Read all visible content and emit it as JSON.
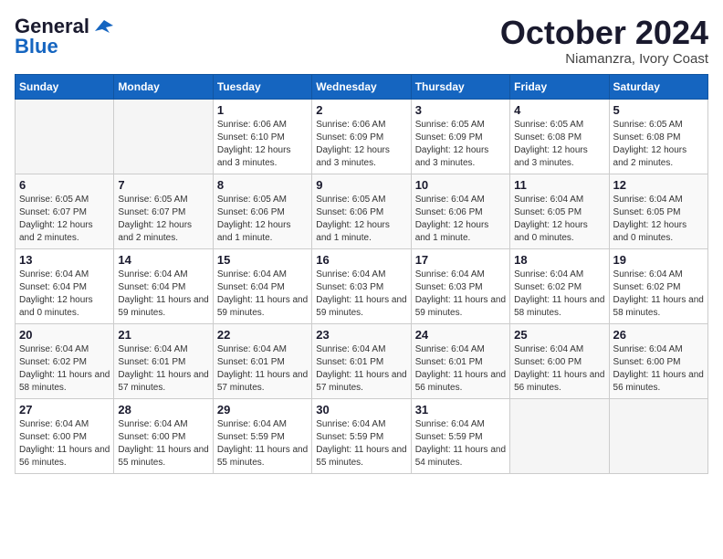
{
  "logo": {
    "general": "General",
    "blue": "Blue",
    "tagline": ""
  },
  "title": "October 2024",
  "subtitle": "Niamanzra, Ivory Coast",
  "days_header": [
    "Sunday",
    "Monday",
    "Tuesday",
    "Wednesday",
    "Thursday",
    "Friday",
    "Saturday"
  ],
  "weeks": [
    [
      {
        "day": "",
        "info": ""
      },
      {
        "day": "",
        "info": ""
      },
      {
        "day": "1",
        "info": "Sunrise: 6:06 AM\nSunset: 6:10 PM\nDaylight: 12 hours and 3 minutes."
      },
      {
        "day": "2",
        "info": "Sunrise: 6:06 AM\nSunset: 6:09 PM\nDaylight: 12 hours and 3 minutes."
      },
      {
        "day": "3",
        "info": "Sunrise: 6:05 AM\nSunset: 6:09 PM\nDaylight: 12 hours and 3 minutes."
      },
      {
        "day": "4",
        "info": "Sunrise: 6:05 AM\nSunset: 6:08 PM\nDaylight: 12 hours and 3 minutes."
      },
      {
        "day": "5",
        "info": "Sunrise: 6:05 AM\nSunset: 6:08 PM\nDaylight: 12 hours and 2 minutes."
      }
    ],
    [
      {
        "day": "6",
        "info": "Sunrise: 6:05 AM\nSunset: 6:07 PM\nDaylight: 12 hours and 2 minutes."
      },
      {
        "day": "7",
        "info": "Sunrise: 6:05 AM\nSunset: 6:07 PM\nDaylight: 12 hours and 2 minutes."
      },
      {
        "day": "8",
        "info": "Sunrise: 6:05 AM\nSunset: 6:06 PM\nDaylight: 12 hours and 1 minute."
      },
      {
        "day": "9",
        "info": "Sunrise: 6:05 AM\nSunset: 6:06 PM\nDaylight: 12 hours and 1 minute."
      },
      {
        "day": "10",
        "info": "Sunrise: 6:04 AM\nSunset: 6:06 PM\nDaylight: 12 hours and 1 minute."
      },
      {
        "day": "11",
        "info": "Sunrise: 6:04 AM\nSunset: 6:05 PM\nDaylight: 12 hours and 0 minutes."
      },
      {
        "day": "12",
        "info": "Sunrise: 6:04 AM\nSunset: 6:05 PM\nDaylight: 12 hours and 0 minutes."
      }
    ],
    [
      {
        "day": "13",
        "info": "Sunrise: 6:04 AM\nSunset: 6:04 PM\nDaylight: 12 hours and 0 minutes."
      },
      {
        "day": "14",
        "info": "Sunrise: 6:04 AM\nSunset: 6:04 PM\nDaylight: 11 hours and 59 minutes."
      },
      {
        "day": "15",
        "info": "Sunrise: 6:04 AM\nSunset: 6:04 PM\nDaylight: 11 hours and 59 minutes."
      },
      {
        "day": "16",
        "info": "Sunrise: 6:04 AM\nSunset: 6:03 PM\nDaylight: 11 hours and 59 minutes."
      },
      {
        "day": "17",
        "info": "Sunrise: 6:04 AM\nSunset: 6:03 PM\nDaylight: 11 hours and 59 minutes."
      },
      {
        "day": "18",
        "info": "Sunrise: 6:04 AM\nSunset: 6:02 PM\nDaylight: 11 hours and 58 minutes."
      },
      {
        "day": "19",
        "info": "Sunrise: 6:04 AM\nSunset: 6:02 PM\nDaylight: 11 hours and 58 minutes."
      }
    ],
    [
      {
        "day": "20",
        "info": "Sunrise: 6:04 AM\nSunset: 6:02 PM\nDaylight: 11 hours and 58 minutes."
      },
      {
        "day": "21",
        "info": "Sunrise: 6:04 AM\nSunset: 6:01 PM\nDaylight: 11 hours and 57 minutes."
      },
      {
        "day": "22",
        "info": "Sunrise: 6:04 AM\nSunset: 6:01 PM\nDaylight: 11 hours and 57 minutes."
      },
      {
        "day": "23",
        "info": "Sunrise: 6:04 AM\nSunset: 6:01 PM\nDaylight: 11 hours and 57 minutes."
      },
      {
        "day": "24",
        "info": "Sunrise: 6:04 AM\nSunset: 6:01 PM\nDaylight: 11 hours and 56 minutes."
      },
      {
        "day": "25",
        "info": "Sunrise: 6:04 AM\nSunset: 6:00 PM\nDaylight: 11 hours and 56 minutes."
      },
      {
        "day": "26",
        "info": "Sunrise: 6:04 AM\nSunset: 6:00 PM\nDaylight: 11 hours and 56 minutes."
      }
    ],
    [
      {
        "day": "27",
        "info": "Sunrise: 6:04 AM\nSunset: 6:00 PM\nDaylight: 11 hours and 56 minutes."
      },
      {
        "day": "28",
        "info": "Sunrise: 6:04 AM\nSunset: 6:00 PM\nDaylight: 11 hours and 55 minutes."
      },
      {
        "day": "29",
        "info": "Sunrise: 6:04 AM\nSunset: 5:59 PM\nDaylight: 11 hours and 55 minutes."
      },
      {
        "day": "30",
        "info": "Sunrise: 6:04 AM\nSunset: 5:59 PM\nDaylight: 11 hours and 55 minutes."
      },
      {
        "day": "31",
        "info": "Sunrise: 6:04 AM\nSunset: 5:59 PM\nDaylight: 11 hours and 54 minutes."
      },
      {
        "day": "",
        "info": ""
      },
      {
        "day": "",
        "info": ""
      }
    ]
  ]
}
